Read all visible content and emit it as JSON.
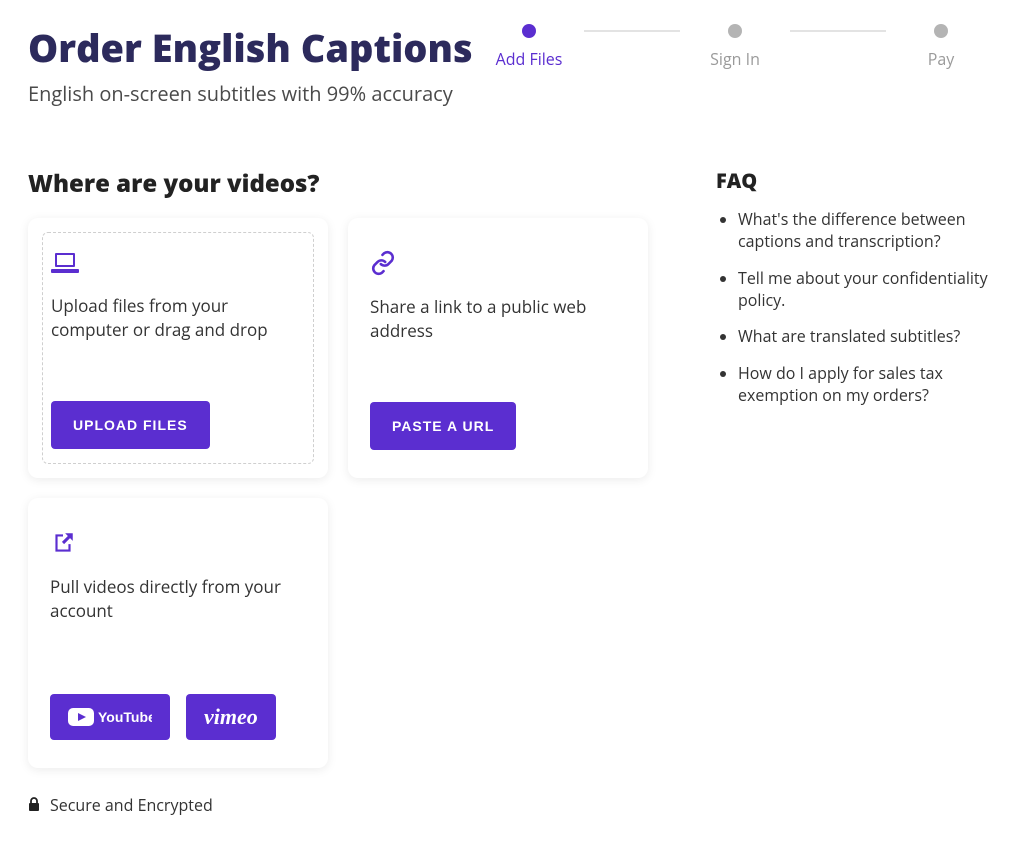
{
  "header": {
    "title": "Order English Captions",
    "subtitle": "English on-screen subtitles with 99% accuracy"
  },
  "stepper": {
    "steps": [
      {
        "label": "Add Files",
        "state": "active"
      },
      {
        "label": "Sign In",
        "state": "upcoming"
      },
      {
        "label": "Pay",
        "state": "upcoming"
      }
    ]
  },
  "section": {
    "title": "Where are your videos?"
  },
  "cards": {
    "upload": {
      "icon": "laptop-icon",
      "text": "Upload files from your computer or drag and drop",
      "button": "Upload Files"
    },
    "link": {
      "icon": "link-icon",
      "text": "Share a link to a public web address",
      "button": "Paste a URL"
    },
    "pull": {
      "icon": "share-out-icon",
      "text": "Pull videos directly from your account",
      "youtube_label": "YouTube",
      "vimeo_label": "vimeo"
    }
  },
  "faq": {
    "title": "FAQ",
    "items": [
      "What's the difference between captions and transcription?",
      "Tell me about your confidentiality policy.",
      "What are translated subtitles?",
      "How do I apply for sales tax exemption on my orders?"
    ]
  },
  "footer": {
    "secure_label": "Secure and Encrypted"
  }
}
